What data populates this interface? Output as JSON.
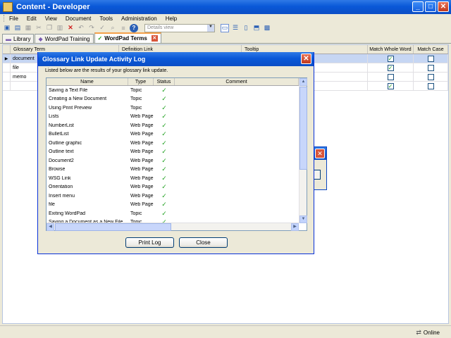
{
  "window": {
    "title": "Content - Developer",
    "min": "_",
    "max": "□",
    "close": "✕"
  },
  "menu": [
    "File",
    "Edit",
    "View",
    "Document",
    "Tools",
    "Administration",
    "Help"
  ],
  "toolbar": {
    "view_select": "Details view"
  },
  "tabs": [
    {
      "label": "Library",
      "active": false,
      "icon": "library-icon"
    },
    {
      "label": "WordPad Training",
      "active": false,
      "icon": "book-icon"
    },
    {
      "label": "WordPad Terms",
      "active": true,
      "icon": "check-icon"
    }
  ],
  "tab_close": "✕",
  "grid": {
    "columns": [
      "Glossary Term",
      "Definition Link",
      "Tooltip",
      "Match Whole Word",
      "Match Case"
    ],
    "rows": [
      {
        "term": "document",
        "whole": true,
        "case": false,
        "selected": true
      },
      {
        "term": "file",
        "whole": true,
        "case": false,
        "selected": false
      },
      {
        "term": "memo",
        "whole": false,
        "case": false,
        "selected": false
      },
      {
        "term": "",
        "whole": true,
        "case": false,
        "selected": false
      }
    ]
  },
  "dialog": {
    "title": "Glossary Link Update Activity Log",
    "close": "✕",
    "description": "Listed below are the results of your glossary link update.",
    "columns": [
      "Name",
      "Type",
      "Status",
      "Comment"
    ],
    "check": "✓",
    "rows": [
      {
        "name": "Saving a Text File",
        "type": "Topic"
      },
      {
        "name": "Creating a New Document",
        "type": "Topic"
      },
      {
        "name": "Using Print Preview",
        "type": "Topic"
      },
      {
        "name": "Lists",
        "type": "Web Page"
      },
      {
        "name": "NumberList",
        "type": "Web Page"
      },
      {
        "name": "BulletList",
        "type": "Web Page"
      },
      {
        "name": "Outline graphic",
        "type": "Web Page"
      },
      {
        "name": "Outline text",
        "type": "Web Page"
      },
      {
        "name": "Document2",
        "type": "Web Page"
      },
      {
        "name": "Browse",
        "type": "Web Page"
      },
      {
        "name": "WSG Link",
        "type": "Web Page"
      },
      {
        "name": "Orientation",
        "type": "Web Page"
      },
      {
        "name": "Insert menu",
        "type": "Web Page"
      },
      {
        "name": "file",
        "type": "Web Page"
      },
      {
        "name": "Exiting WordPad",
        "type": "Topic"
      },
      {
        "name": "Saving a Document as a New File",
        "type": "Topic"
      }
    ],
    "print_button": "Print Log",
    "close_button": "Close"
  },
  "status": {
    "online": "Online"
  },
  "colors": {
    "title_blue": "#0a58d8",
    "status_green": "#21a121",
    "selection": "#c6d6f3"
  }
}
